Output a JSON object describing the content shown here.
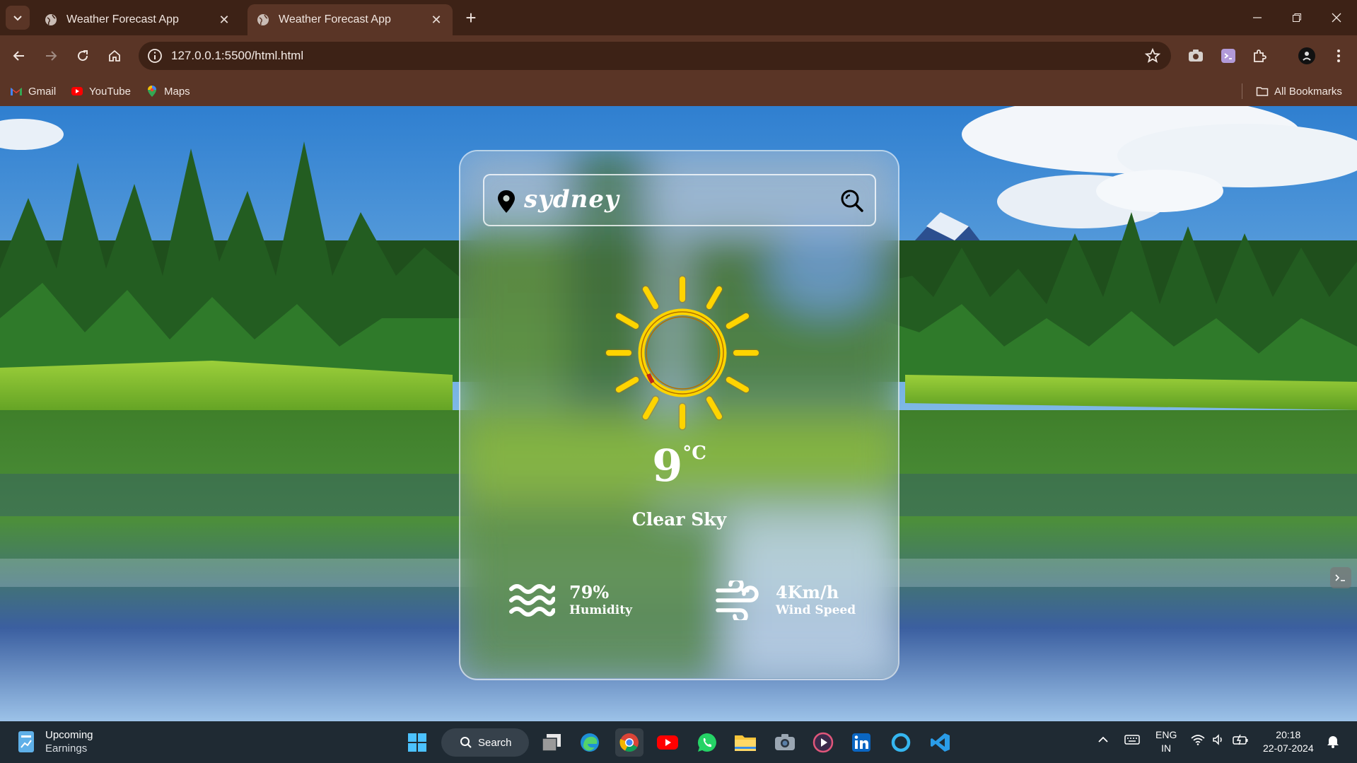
{
  "browser": {
    "tabs": [
      {
        "title": "Weather Forecast App",
        "active": false
      },
      {
        "title": "Weather Forecast App",
        "active": true
      }
    ],
    "url": "127.0.0.1:5500/html.html",
    "bookmarks": [
      "Gmail",
      "YouTube",
      "Maps"
    ],
    "all_bookmarks_label": "All Bookmarks"
  },
  "weather": {
    "city": "sydney",
    "temperature": "9",
    "unit": "°C",
    "condition": "Clear Sky",
    "humidity_value": "79%",
    "humidity_label": "Humidity",
    "wind_value": "4Km/h",
    "wind_label": "Wind Speed"
  },
  "taskbar": {
    "widget_title": "Upcoming",
    "widget_subtitle": "Earnings",
    "search_label": "Search",
    "language": "ENG",
    "region": "IN",
    "time": "20:18",
    "date": "22-07-2024",
    "apps": [
      "start-icon",
      "task-view-icon",
      "edge-icon",
      "chrome-icon",
      "youtube-icon",
      "whatsapp-icon",
      "file-explorer-icon",
      "camera-icon",
      "media-player-icon",
      "linkedin-icon",
      "cortana-icon",
      "vscode-icon"
    ]
  },
  "colors": {
    "chrome_dark": "#3d2216",
    "chrome_light": "#5a3526",
    "sun_yellow": "#ffd400",
    "taskbar": "#1f2a33"
  }
}
